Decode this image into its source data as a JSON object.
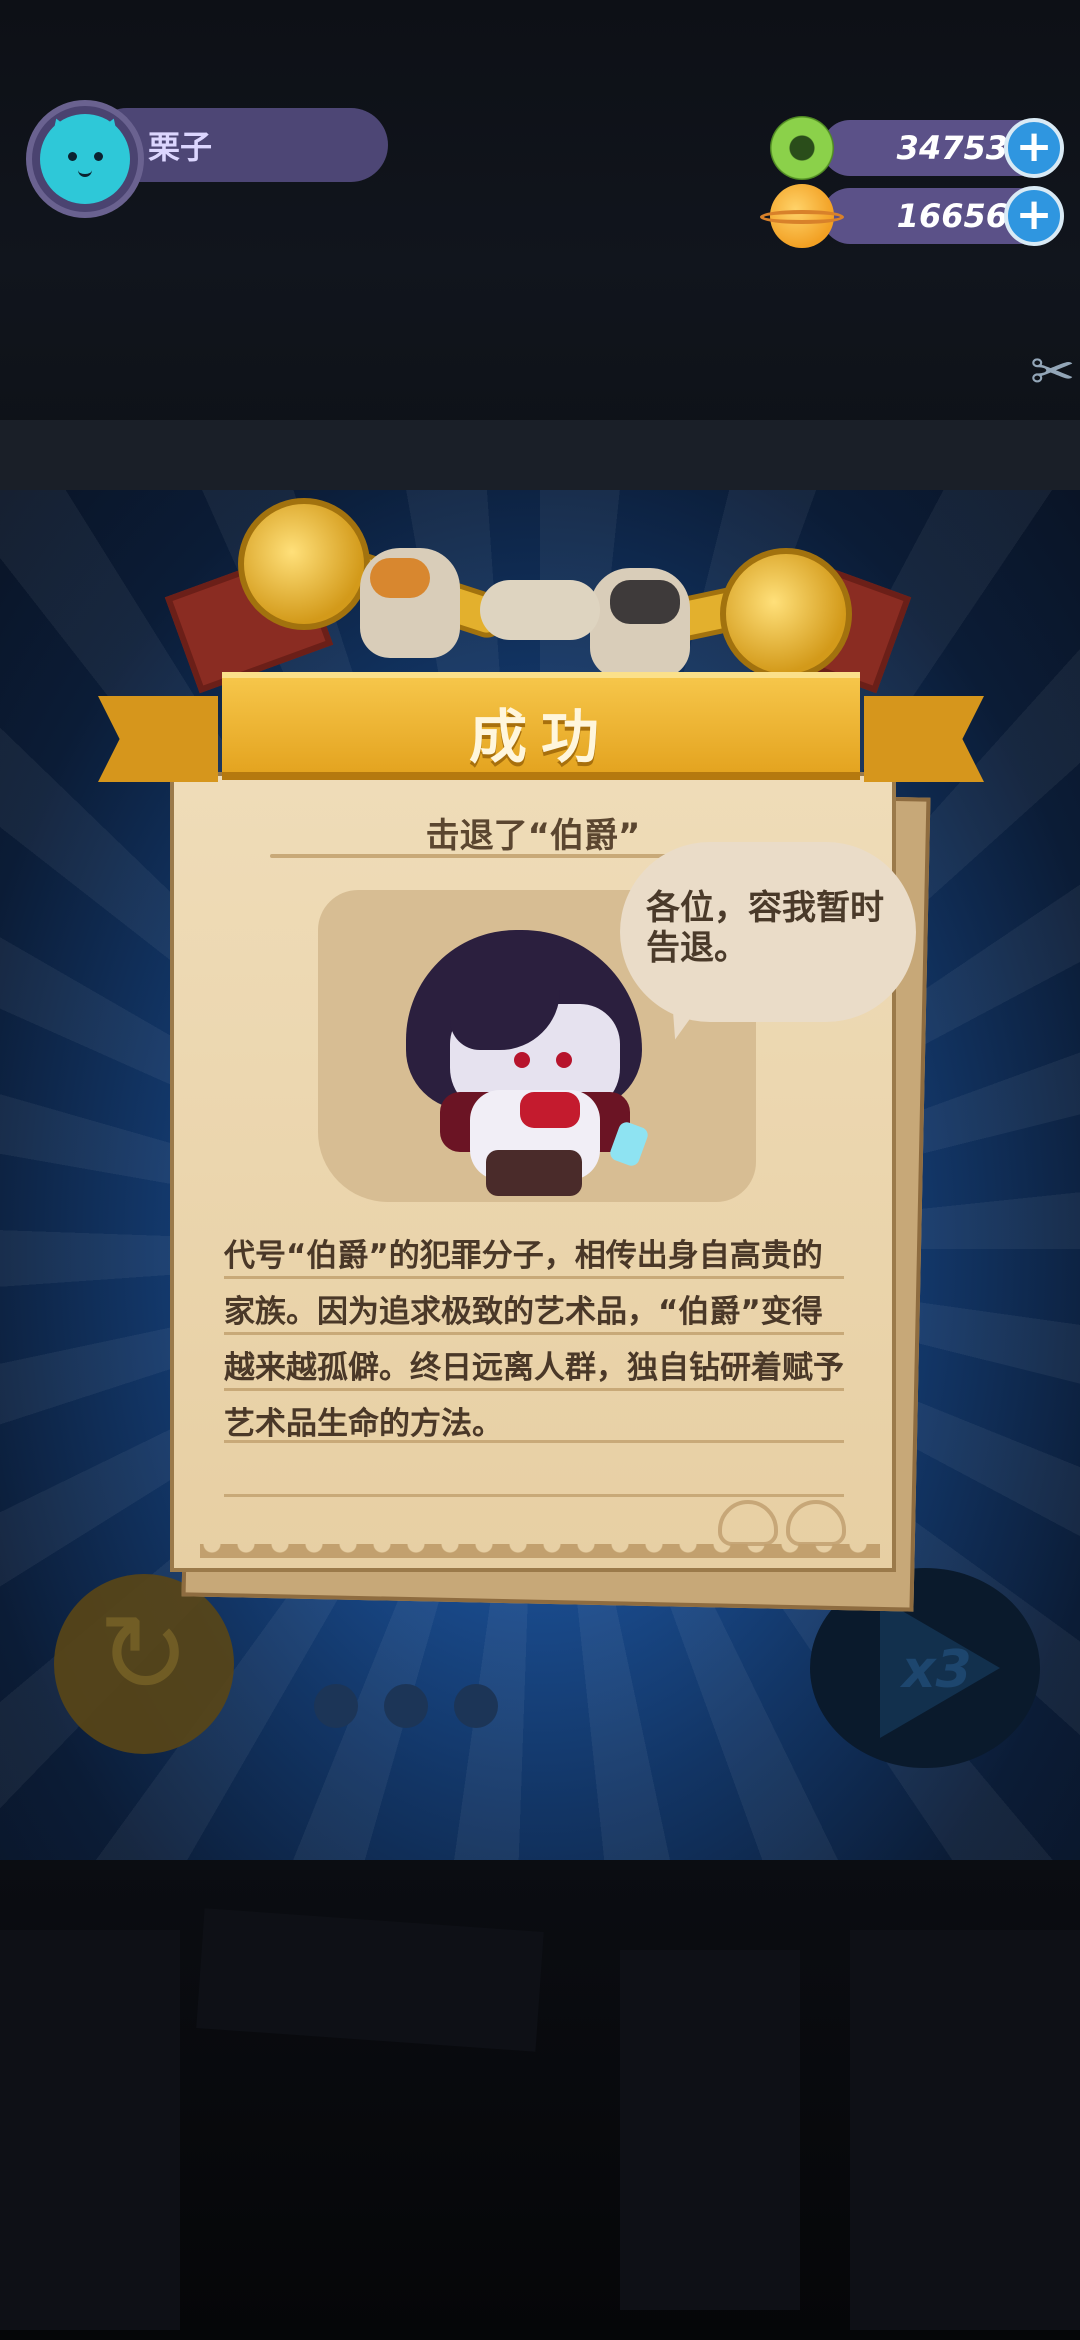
{
  "player": {
    "name": "栗子",
    "avatar_icon": "cat-face-icon"
  },
  "currencies": [
    {
      "icon": "green-gem-coin-icon",
      "value": "34753",
      "plus_label": "+"
    },
    {
      "icon": "planet-coin-icon",
      "value": "16656",
      "plus_label": "+"
    }
  ],
  "side_button_icon": "scissors-icon",
  "result": {
    "banner": "成功",
    "subtitle": "击退了“伯爵”",
    "speech": "各位，容我暂时告退。",
    "description_lines": [
      "代号“伯爵”的犯罪分子，相传出身自高贵的",
      "家族。因为追求极致的艺术品，“伯爵”变得",
      "越来越孤僻。终日远离人群，独自钻研着赋予",
      "艺术品生命的方法。"
    ]
  },
  "controls": {
    "retry_icon": "retry-icon",
    "speed_label": "x3"
  },
  "colors": {
    "banner": "#e4a420",
    "paper": "#efdcb8",
    "accent_blue": "#2f96e0",
    "pill": "#4d4675"
  }
}
